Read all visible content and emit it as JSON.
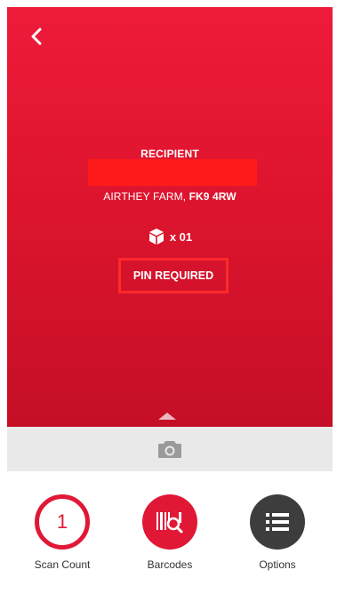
{
  "colors": {
    "brand_red": "#e01836",
    "highlight_red": "#ff2a2a",
    "dark": "#3d3d3d",
    "camera_bar": "#e9e9e9"
  },
  "header": {
    "back_icon": "chevron-left-icon"
  },
  "delivery": {
    "recipient_label": "RECIPIENT",
    "address_prefix": "AIRTHEY FARM, ",
    "address_postcode": "FK9 4RW",
    "parcel_icon": "package-icon",
    "parcel_count": "x 01",
    "pin_status": "PIN REQUIRED"
  },
  "camera": {
    "icon": "camera-icon"
  },
  "actions": {
    "scan_count": {
      "value": "1",
      "label": "Scan Count"
    },
    "barcodes": {
      "label": "Barcodes",
      "icon": "barcode-search-icon"
    },
    "options": {
      "label": "Options",
      "icon": "list-icon"
    }
  }
}
